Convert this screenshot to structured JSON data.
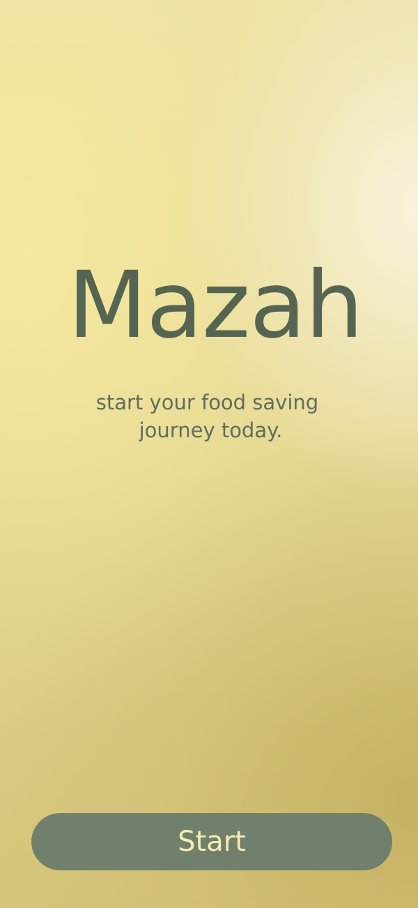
{
  "app": {
    "title": "Mazah",
    "tagline_line1": "start your food saving",
    "tagline_line2": "journey today."
  },
  "actions": {
    "start_label": "Start"
  },
  "colors": {
    "title_text": "#566551",
    "tagline_text": "#5f6e5c",
    "button_background": "#71806c",
    "button_text": "#f6ecb2",
    "background_light": "#f3eecd",
    "background_mid": "#e8dc9a",
    "background_dark": "#c9b66a"
  }
}
